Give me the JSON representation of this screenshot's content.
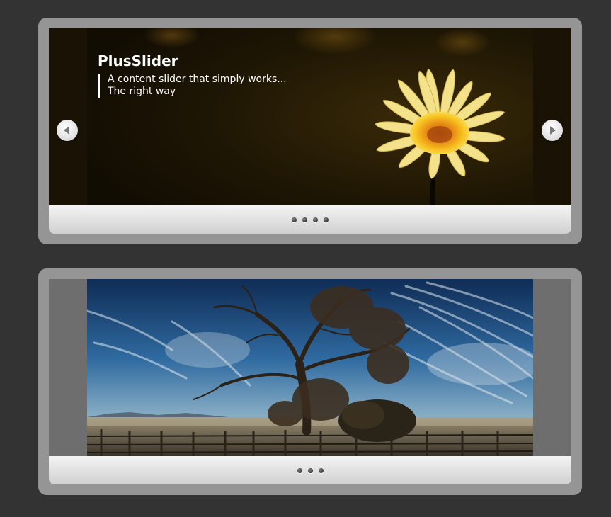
{
  "slider_top": {
    "title": "PlusSlider",
    "caption_lines": [
      "A content slider that simply works...",
      "The right way"
    ],
    "image": "yellow-daisy-photo",
    "prev_icon": "chevron-left-icon",
    "next_icon": "chevron-right-icon",
    "pager_dot_count": 4
  },
  "slider_bottom": {
    "image": "bare-tree-landscape-photo",
    "pager_dot_count": 3
  },
  "colors": {
    "background": "#333333",
    "frame": "#959595",
    "caption_text": "#ffffff"
  }
}
